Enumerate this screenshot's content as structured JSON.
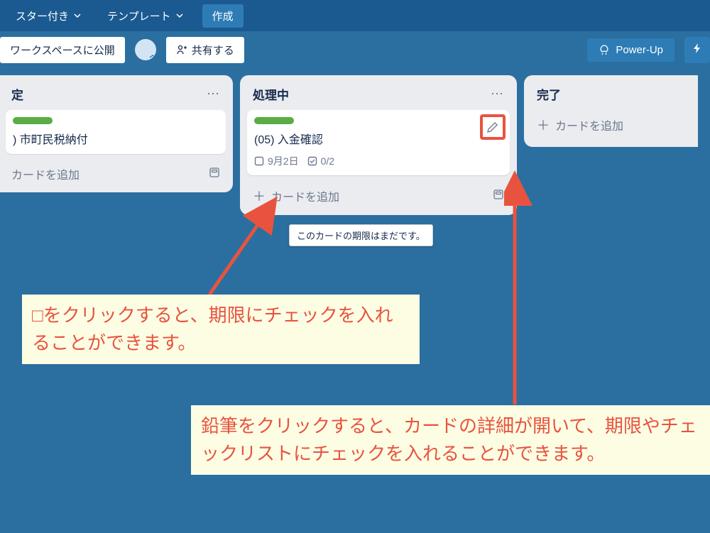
{
  "nav": {
    "starred": "スター付き",
    "templates": "テンプレート",
    "create": "作成"
  },
  "header": {
    "visibility": "ワークスペースに公開",
    "share": "共有する",
    "powerup": "Power-Up"
  },
  "lists": {
    "todo": {
      "title": "定",
      "card1_title": ") 市町民税納付",
      "add_card": "カードを追加"
    },
    "doing": {
      "title": "処理中",
      "card1_title": "(05) 入金確認",
      "card1_date": "9月2日",
      "card1_checklist": "0/2",
      "add_card": "カードを追加"
    },
    "done": {
      "title": "完了",
      "add_card": "カードを追加"
    }
  },
  "tooltip": "このカードの期限はまだです。",
  "annotations": {
    "a1": "□をクリックすると、期限にチェックを入れることができます。",
    "a2": "鉛筆をクリックすると、カードの詳細が開いて、期限やチェックリストにチェックを入れることができます。"
  }
}
